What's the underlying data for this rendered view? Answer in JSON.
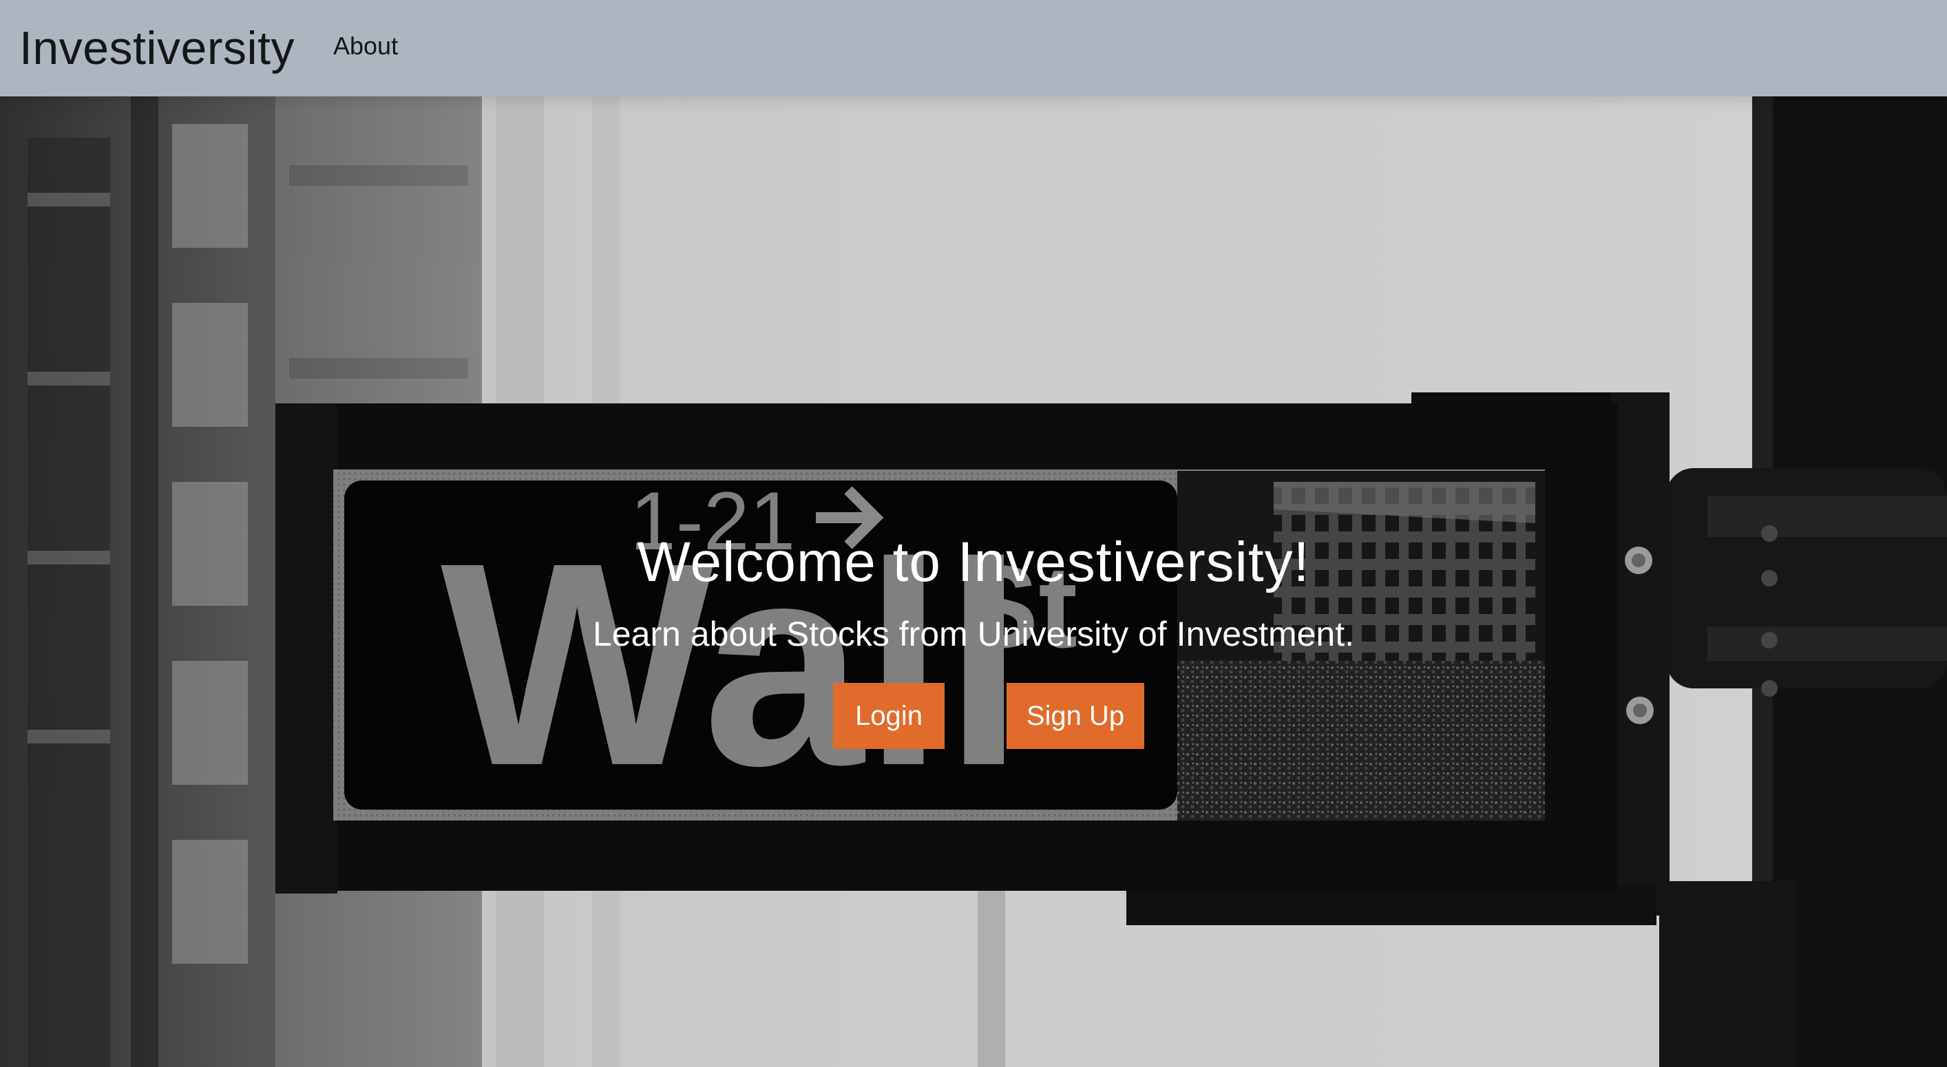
{
  "navbar": {
    "brand": "Investiversity",
    "links": [
      {
        "label": "About"
      }
    ]
  },
  "hero": {
    "title": "Welcome to Investiversity!",
    "subtitle": "Learn about Stocks from University of Investment.",
    "buttons": {
      "login": "Login",
      "signup": "Sign Up"
    },
    "background_sign": {
      "street": "Wall",
      "suffix": "St",
      "block": "1-21"
    }
  },
  "colors": {
    "navbar_bg": "#abb6c1",
    "button_accent": "#e06b2c",
    "hero_text": "#ffffff"
  }
}
